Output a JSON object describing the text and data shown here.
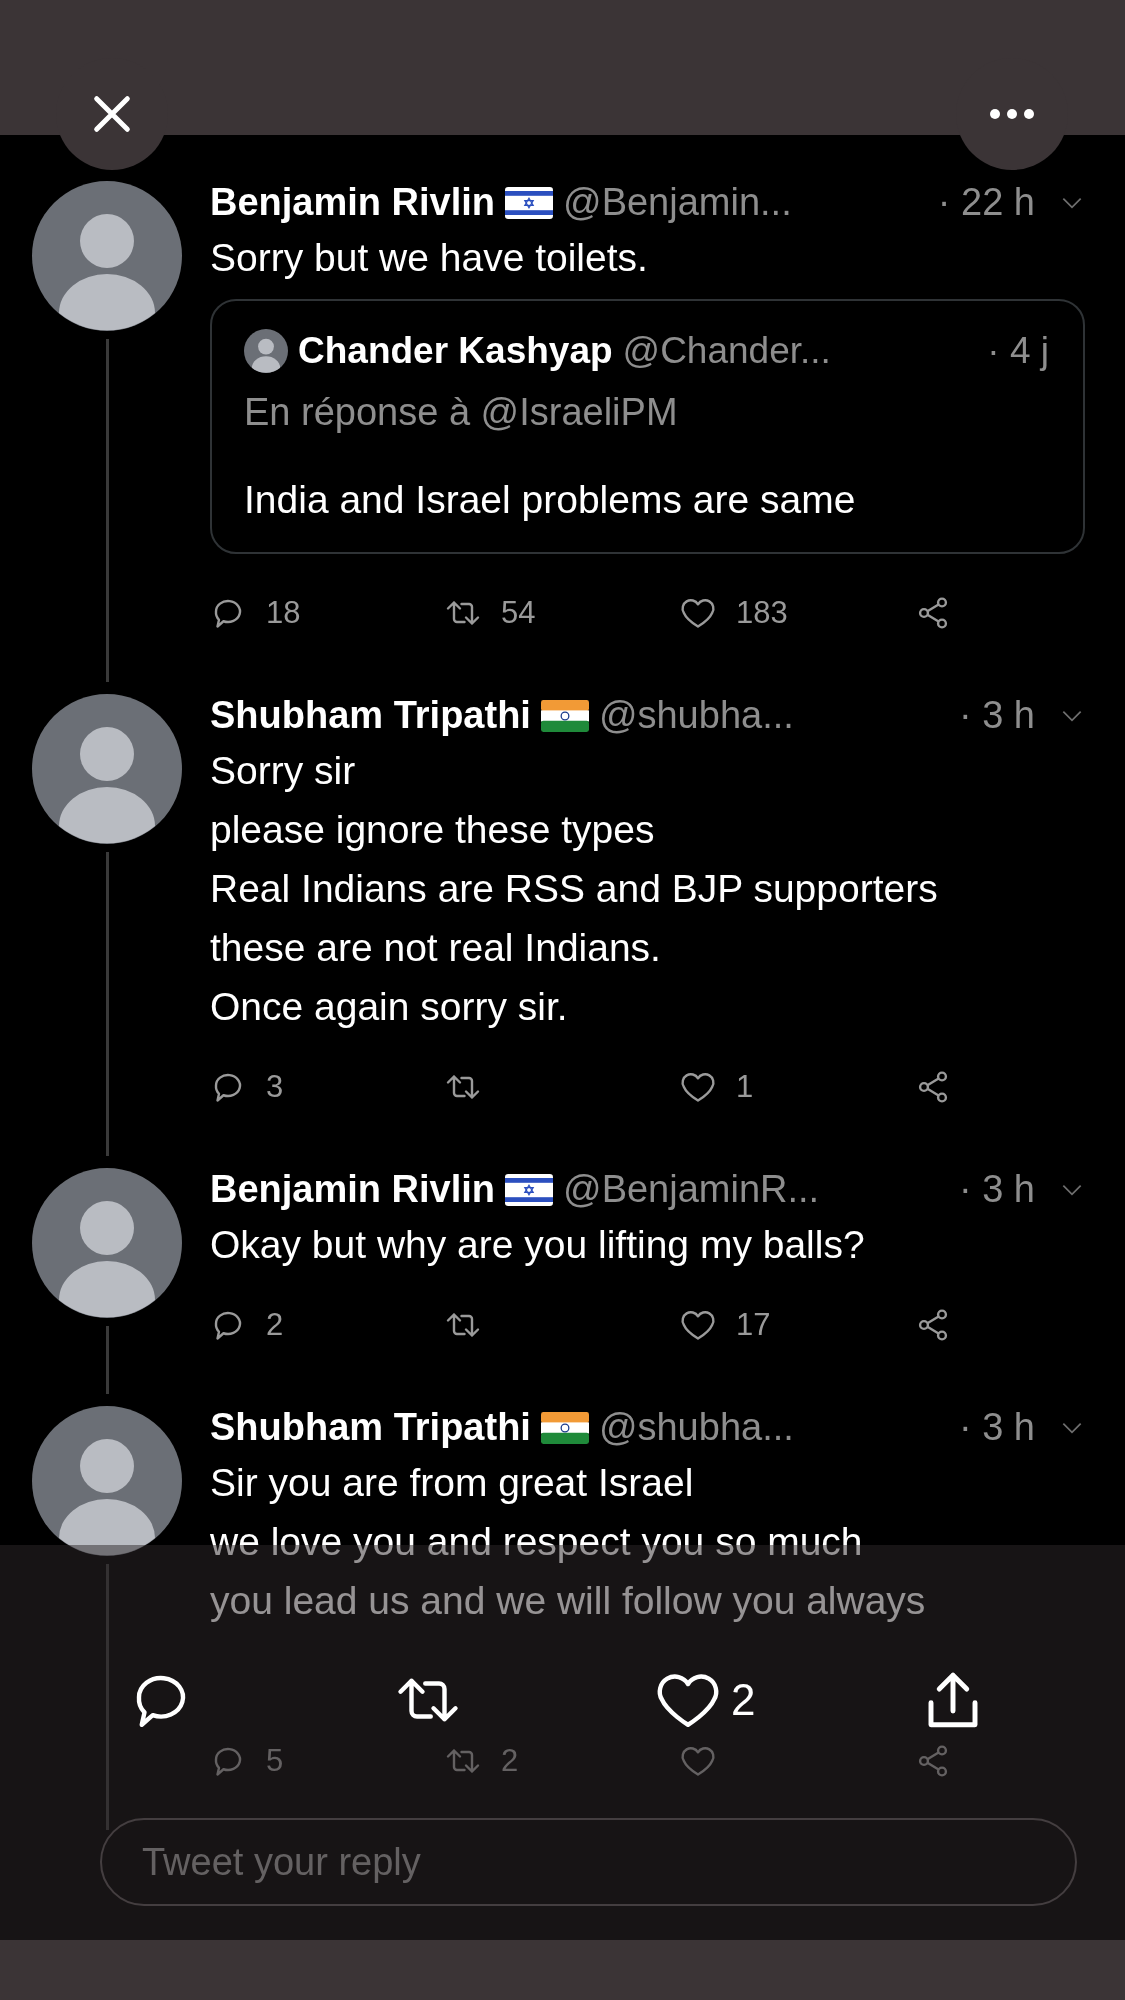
{
  "tweets": [
    {
      "author": "Benjamin Rivlin",
      "flag": {
        "kind": "israel"
      },
      "handle": "@Benjamin...",
      "time": "· 22 h",
      "text": "Sorry but we have toilets.",
      "quote": {
        "author": "Chander Kashyap",
        "handle": "@Chander...",
        "time": "· 4 j",
        "reply_to": "En réponse à @IsraeliPM",
        "text": "India and Israel problems are same"
      },
      "actions": {
        "replies": "18",
        "retweets": "54",
        "likes": "183"
      }
    },
    {
      "author": "Shubham Tripathi",
      "flag": {
        "kind": "india"
      },
      "handle": "@shubha...",
      "time": "· 3 h",
      "text": "Sorry sir\nplease ignore these types\nReal Indians are RSS and BJP supporters\nthese are not real Indians.\nOnce again sorry sir.",
      "actions": {
        "replies": "3",
        "likes": "1"
      }
    },
    {
      "author": "Benjamin Rivlin",
      "flag": {
        "kind": "israel"
      },
      "handle": "@BenjaminR...",
      "time": "· 3 h",
      "text": "Okay but why are you lifting my balls?",
      "actions": {
        "replies": "2",
        "likes": "17"
      }
    },
    {
      "author": "Shubham Tripathi",
      "flag": {
        "kind": "india"
      },
      "handle": "@shubha...",
      "time": "· 3 h",
      "text": "Sir you are from great Israel\nwe love you and respect you so much\nyou lead us and we will follow you always",
      "actions": {
        "replies": "5",
        "retweets": "2"
      }
    }
  ],
  "media_overlay": {
    "likes": "2"
  },
  "reply_box": {
    "placeholder": "Tweet your reply"
  }
}
